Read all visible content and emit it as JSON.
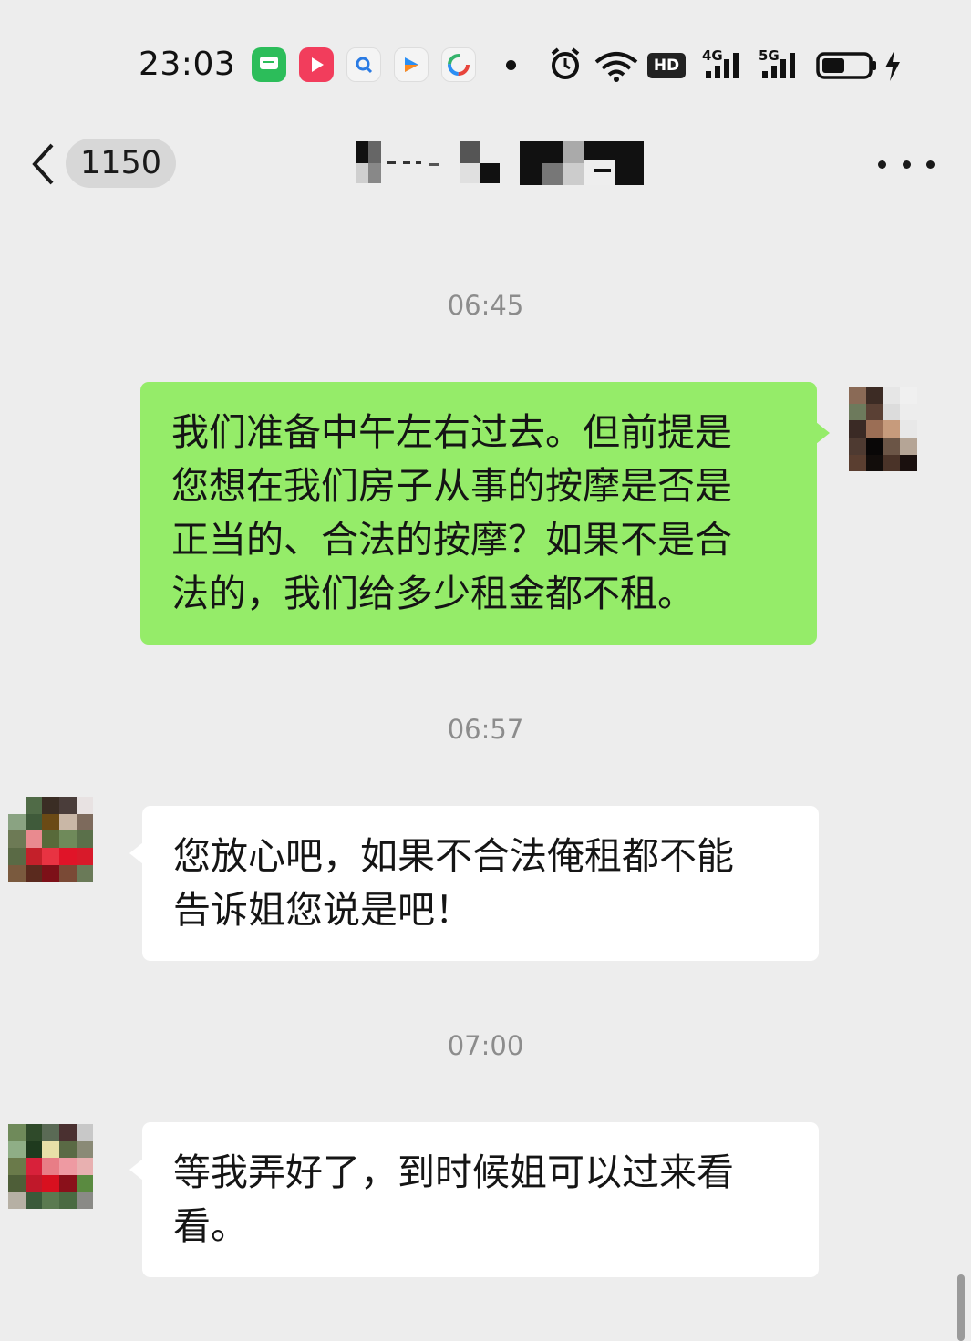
{
  "status_bar": {
    "time": "23:03",
    "apps": [
      "messages-app-icon",
      "video-app-icon",
      "search-app-icon",
      "player-app-icon",
      "browser-app-icon"
    ],
    "hd_label": "HD",
    "net1_label": "4G",
    "net2_label": "5G",
    "icons": [
      "alarm-icon",
      "wifi-icon",
      "signal-icon",
      "battery-icon",
      "charging-icon"
    ]
  },
  "header": {
    "unread_count": "1150",
    "back_icon": "chevron-left-icon",
    "more_icon": "more-dots-icon"
  },
  "messages": [
    {
      "type": "time",
      "text": "06:45"
    },
    {
      "type": "sent",
      "lines": [
        "我们准备中午左右过去。但前提是",
        "您想在我们房子从事的按摩是否是",
        "正当的、合法的按摩？如果不是合",
        "法的，我们给多少租金都不租。"
      ]
    },
    {
      "type": "time",
      "text": "06:57"
    },
    {
      "type": "received",
      "lines": [
        "您放心吧，如果不合法俺租都不能",
        "告诉姐您说是吧！"
      ]
    },
    {
      "type": "time",
      "text": "07:00"
    },
    {
      "type": "received",
      "lines": [
        "等我弄好了，到时候姐可以过来看",
        "看。"
      ]
    }
  ],
  "colors": {
    "background": "#ededed",
    "sent_bubble": "#95ec69",
    "received_bubble": "#ffffff",
    "timestamp": "#8c8c8c"
  }
}
